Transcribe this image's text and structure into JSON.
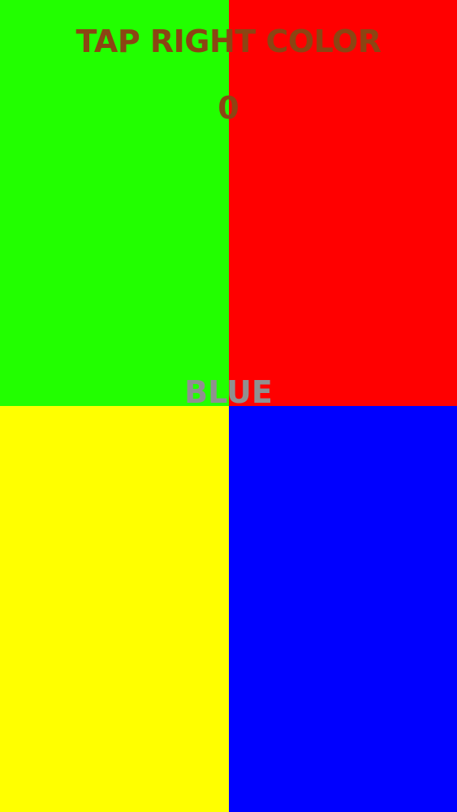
{
  "game": {
    "title": "TAP RIGHT COLOR",
    "score": "0",
    "prompt": "BLUE",
    "title_color": "#8B4513",
    "prompt_color": "#909090"
  },
  "tiles": [
    {
      "name": "green",
      "color": "#22FF00"
    },
    {
      "name": "red",
      "color": "#FF0000"
    },
    {
      "name": "yellow",
      "color": "#FFFF00"
    },
    {
      "name": "blue",
      "color": "#0000FF"
    }
  ]
}
